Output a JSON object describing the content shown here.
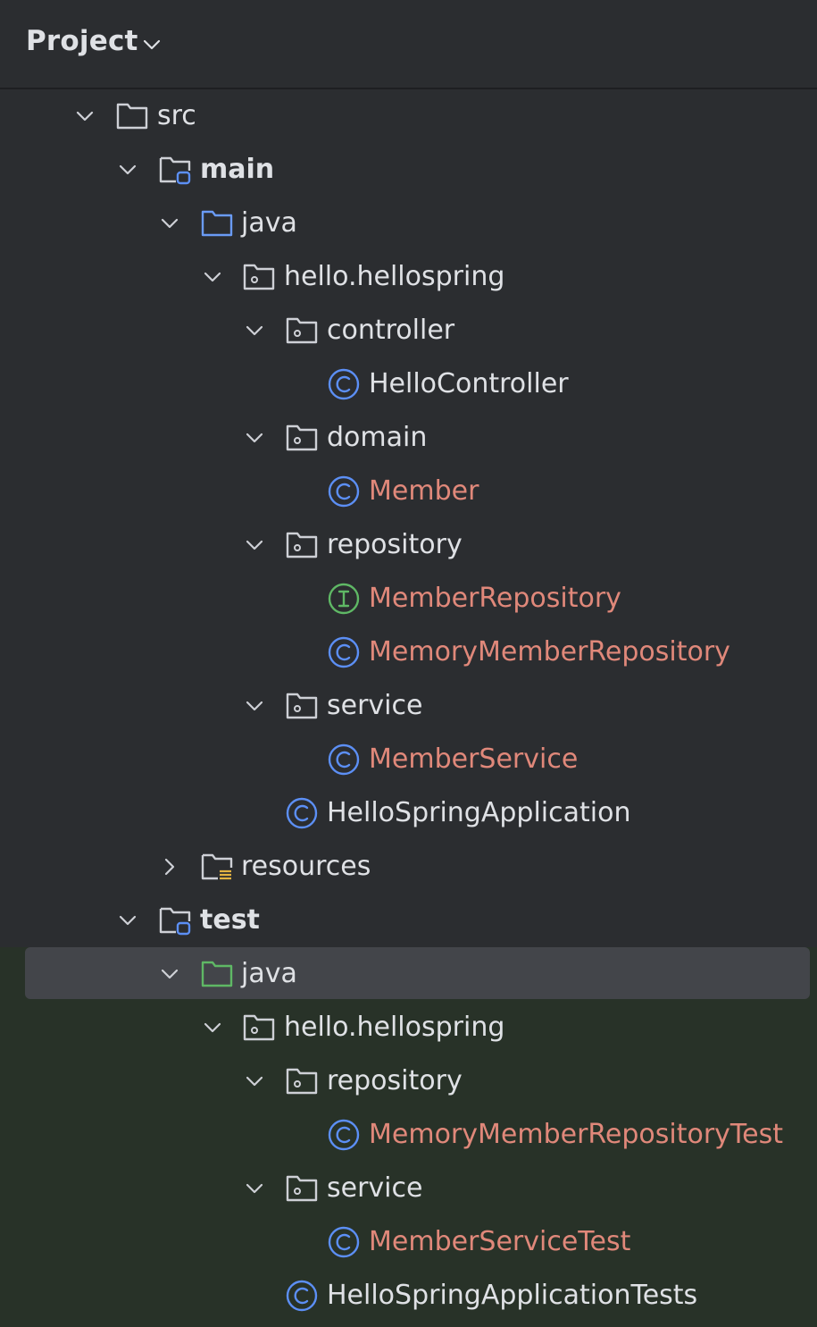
{
  "header": {
    "title": "Project"
  },
  "colors": {
    "text": "#dfe1e5",
    "modified_text": "#e0887a",
    "class_icon": "#5c8ff5",
    "interface_icon": "#5fb865",
    "folder_icon": "#ced0d6",
    "java_main_folder": "#6a9bf5",
    "java_test_folder": "#5fb865",
    "test_background": "#283228",
    "selection": "#43454a"
  },
  "tree": [
    {
      "label": "src",
      "icon": "folder-icon",
      "toggle": "expanded"
    },
    {
      "label": "main",
      "icon": "source-root-folder-icon",
      "toggle": "expanded"
    },
    {
      "label": "java",
      "icon": "java-sources-folder-icon",
      "toggle": "expanded"
    },
    {
      "label": "hello.hellospring",
      "icon": "package-icon",
      "toggle": "expanded"
    },
    {
      "label": "controller",
      "icon": "package-icon",
      "toggle": "expanded"
    },
    {
      "label": "HelloController",
      "icon": "class-icon",
      "toggle": "none"
    },
    {
      "label": "domain",
      "icon": "package-icon",
      "toggle": "expanded"
    },
    {
      "label": "Member",
      "icon": "class-icon",
      "toggle": "none"
    },
    {
      "label": "repository",
      "icon": "package-icon",
      "toggle": "expanded"
    },
    {
      "label": "MemberRepository",
      "icon": "interface-icon",
      "toggle": "none"
    },
    {
      "label": "MemoryMemberRepository",
      "icon": "class-icon",
      "toggle": "none"
    },
    {
      "label": "service",
      "icon": "package-icon",
      "toggle": "expanded"
    },
    {
      "label": "MemberService",
      "icon": "class-icon",
      "toggle": "none"
    },
    {
      "label": "HelloSpringApplication",
      "icon": "class-icon",
      "toggle": "none"
    },
    {
      "label": "resources",
      "icon": "resources-folder-icon",
      "toggle": "collapsed"
    },
    {
      "label": "test",
      "icon": "source-root-folder-icon",
      "toggle": "expanded"
    },
    {
      "label": "java",
      "icon": "test-sources-folder-icon",
      "toggle": "expanded"
    },
    {
      "label": "hello.hellospring",
      "icon": "package-icon",
      "toggle": "expanded"
    },
    {
      "label": "repository",
      "icon": "package-icon",
      "toggle": "expanded"
    },
    {
      "label": "MemoryMemberRepositoryTest",
      "icon": "class-icon",
      "toggle": "none"
    },
    {
      "label": "service",
      "icon": "package-icon",
      "toggle": "expanded"
    },
    {
      "label": "MemberServiceTest",
      "icon": "class-icon",
      "toggle": "none"
    },
    {
      "label": "HelloSpringApplicationTests",
      "icon": "class-icon",
      "toggle": "none"
    }
  ]
}
